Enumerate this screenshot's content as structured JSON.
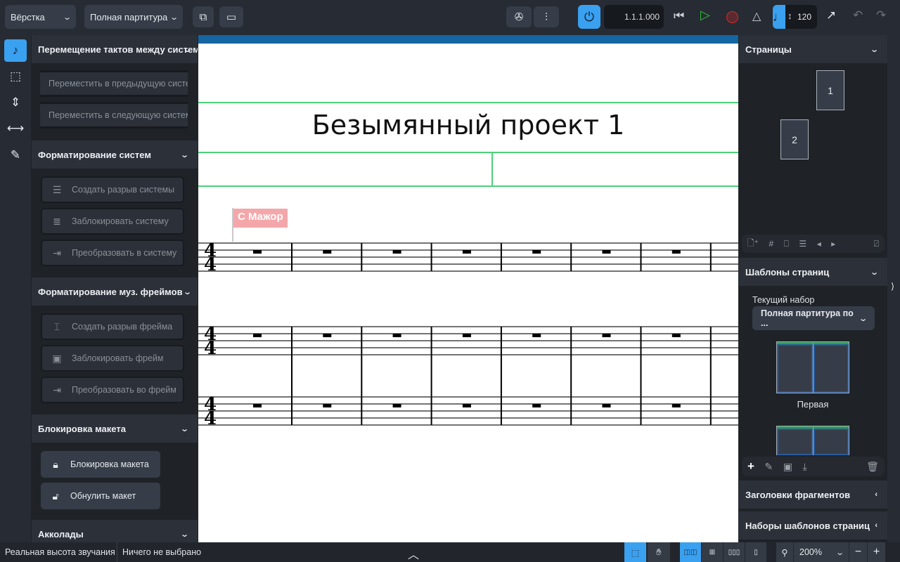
{
  "toolbar": {
    "mode": "Вёрстка",
    "layout": "Полная партитура",
    "position": "1.1.1.000",
    "tempo": "120",
    "icons": [
      "new-tab-icon",
      "window-icon",
      "video-icon",
      "mixer-icon",
      "power-icon",
      "rewind-icon",
      "play-icon",
      "record-icon",
      "metronome-icon",
      "quarter-note-icon",
      "export-icon",
      "undo-icon",
      "redo-icon"
    ],
    "colors": {
      "accent": "#3aa0f0",
      "play": "#2fc43a",
      "record": "#d02a2a"
    }
  },
  "left_tools": [
    "note-input-icon",
    "selection-frame-icon",
    "vertical-spacing-icon",
    "horizontal-spacing-icon",
    "pen-icon"
  ],
  "left_panel": {
    "sections": [
      {
        "title": "Перемещение тактов между системами",
        "buttons": [
          "Переместить в предыдущую систему",
          "Переместить в следующую систему"
        ]
      },
      {
        "title": "Форматирование систем",
        "buttons": [
          "Создать разрыв системы",
          "Заблокировать систему",
          "Преобразовать в систему"
        ]
      },
      {
        "title": "Форматирование муз. фреймов",
        "buttons": [
          "Создать разрыв фрейма",
          "Заблокировать фрейм",
          "Преобразовать во фрейм"
        ]
      },
      {
        "title": "Блокировка макета",
        "buttons": [
          "Блокировка макета",
          "Обнулить макет"
        ]
      },
      {
        "title": "Акколады"
      }
    ]
  },
  "score": {
    "title": "Безымянный проект 1",
    "key_signature": "С Мажор",
    "time_signature": {
      "numerator": "4",
      "denominator": "4"
    },
    "staves": 3,
    "measures_visible": 8
  },
  "right_panel": {
    "pages": {
      "title": "Страницы",
      "items": [
        "1",
        "2"
      ]
    },
    "page_templates": {
      "title": "Шаблоны страниц",
      "current_set_label": "Текущий набор",
      "current_set": "Полная партитура по ...",
      "templates": [
        "Первая",
        ""
      ]
    },
    "flow_headings": {
      "title": "Заголовки фрагментов"
    },
    "page_template_sets": {
      "title": "Наборы шаблонов страниц"
    }
  },
  "status": {
    "pitch": "Реальная высота звучания",
    "selection": "Ничего не выбрано",
    "zoom": "200%"
  }
}
